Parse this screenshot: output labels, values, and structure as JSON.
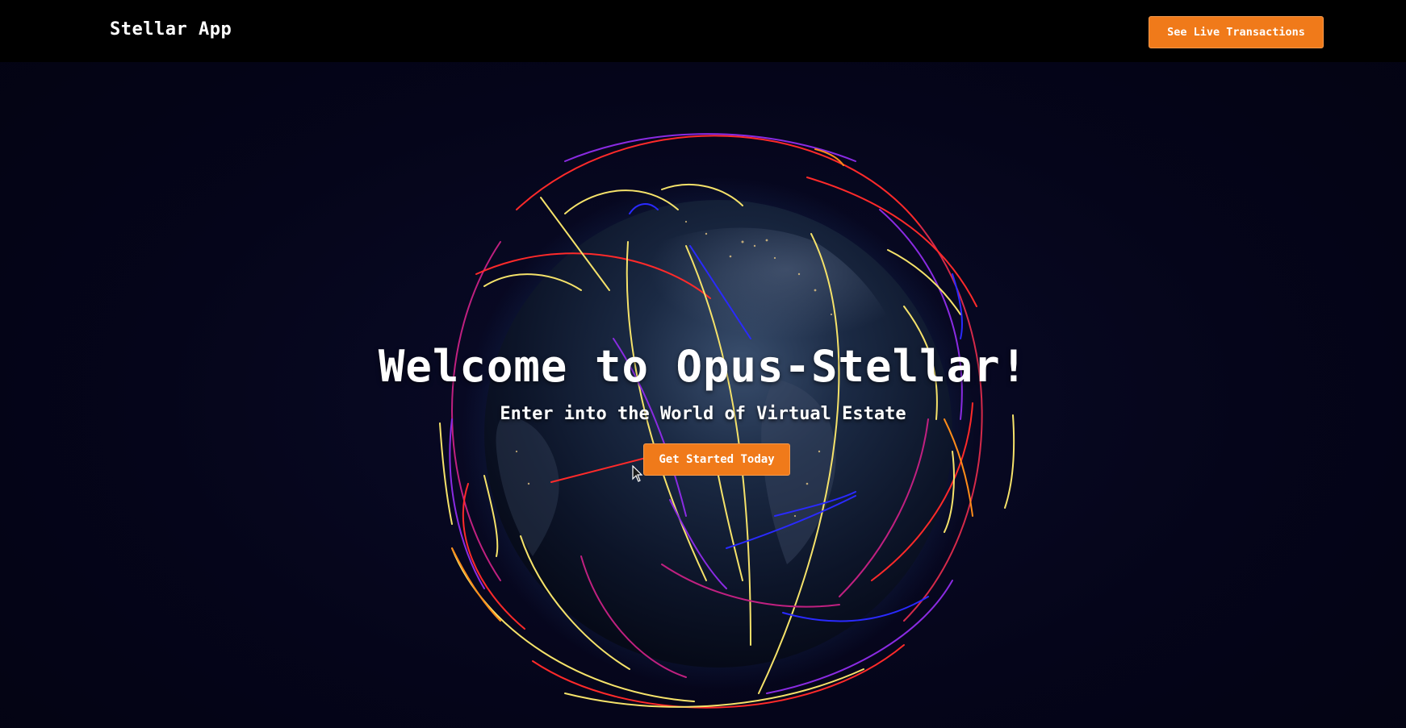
{
  "navbar": {
    "brand": "Stellar App",
    "live_transactions_label": "See Live Transactions"
  },
  "hero": {
    "title": "Welcome to Opus-Stellar!",
    "subtitle": "Enter into the World of Virtual Estate",
    "cta_label": "Get Started Today"
  },
  "colors": {
    "accent": "#f07a1a",
    "navbar_bg": "#000000",
    "page_bg": "#05051a",
    "arc_colors": [
      "#ff2a2a",
      "#f5e26a",
      "#8a2be2",
      "#2222ff",
      "#c02080",
      "#ff8c1a"
    ]
  }
}
